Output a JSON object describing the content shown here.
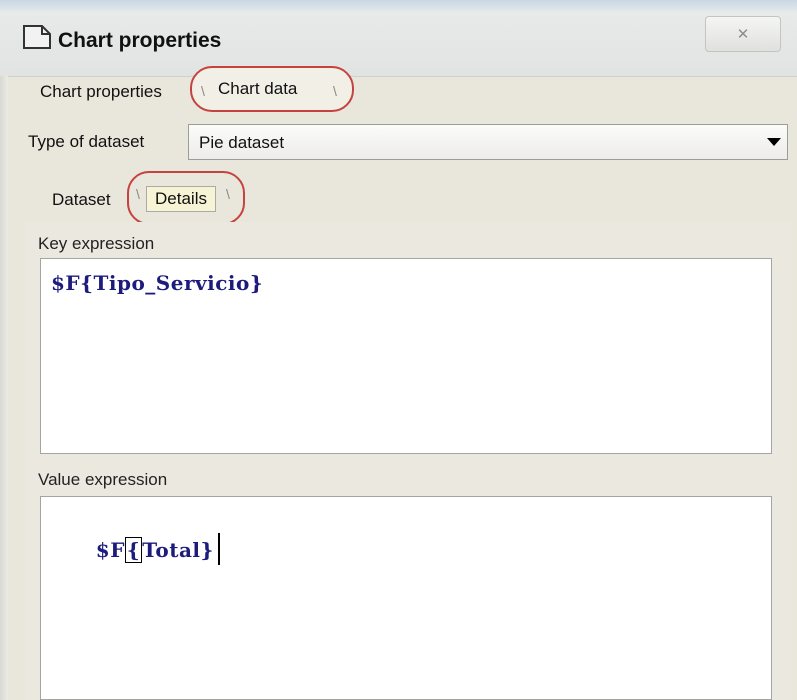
{
  "window": {
    "title": "Chart properties",
    "close_label": "✕",
    "icon": "chart-window-icon"
  },
  "main_tabs": {
    "items": [
      {
        "label": "Chart properties",
        "selected": false
      },
      {
        "label": "Chart data",
        "selected": true
      }
    ]
  },
  "dataset": {
    "label": "Type of dataset",
    "selected_value": "Pie dataset"
  },
  "sub_tabs": {
    "items": [
      {
        "label": "Dataset",
        "selected": false
      },
      {
        "label": "Details",
        "selected": true
      }
    ]
  },
  "fields": {
    "key_expression": {
      "label": "Key expression",
      "value": "$F{Tipo_Servicio}"
    },
    "value_expression": {
      "label": "Value expression",
      "prefix": "$F",
      "brace": "{",
      "rest": "Total}"
    }
  },
  "colors": {
    "highlight_outline": "#c4433f",
    "code_text": "#1d1c7c"
  }
}
